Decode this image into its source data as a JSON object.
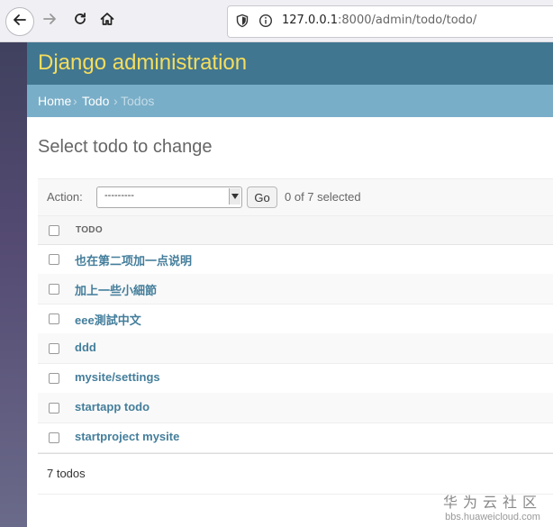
{
  "browser": {
    "url_host": "127.0.0.1",
    "url_rest": ":8000/admin/todo/todo/"
  },
  "header": {
    "branding": "Django administration",
    "brand_color": "#417690"
  },
  "breadcrumbs": {
    "home": "Home",
    "sep1": "›",
    "app": "Todo",
    "sep2": "›",
    "current": "Todos"
  },
  "page": {
    "title": "Select todo to change"
  },
  "actions": {
    "label": "Action:",
    "selected_value": "---------",
    "go_label": "Go",
    "selected_count": "0 of 7 selected"
  },
  "table": {
    "column_header": "TODO",
    "rows": [
      "也在第二项加一点说明",
      "加上一些小細節",
      "eee測試中文",
      "ddd",
      "mysite/settings",
      "startapp todo",
      "startproject mysite"
    ]
  },
  "paginator": {
    "count_text": "7 todos"
  },
  "watermark": {
    "cn": "华为云社区",
    "url": "bbs.huaweicloud.com"
  },
  "icons": {
    "back": "back-arrow-icon",
    "forward": "forward-arrow-icon",
    "reload": "reload-icon",
    "home": "home-icon",
    "shield": "shield-icon",
    "info": "info-icon"
  }
}
